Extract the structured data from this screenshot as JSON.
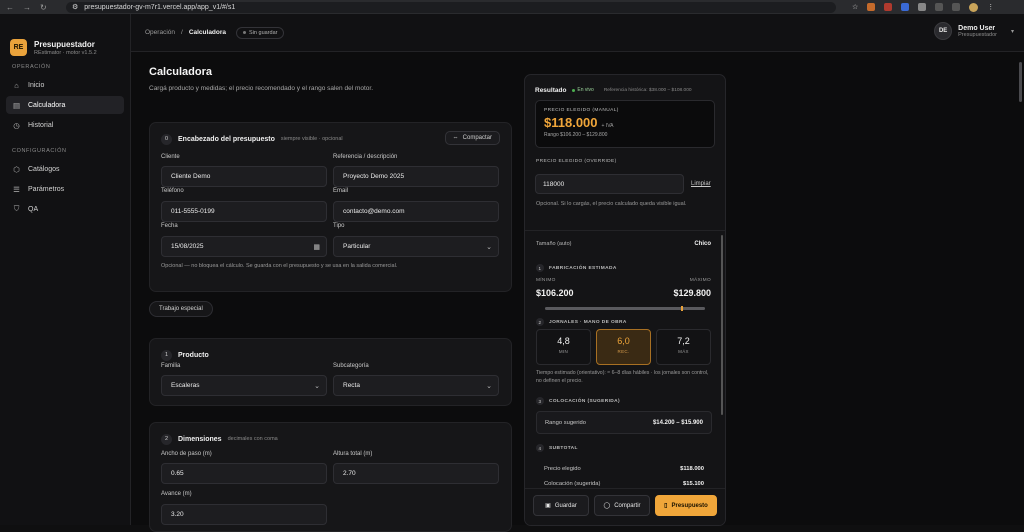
{
  "browser": {
    "url": "presupuestador-gv-m7r1.vercel.app/app_v1/#/s1",
    "nav_back": "←",
    "nav_forward": "→",
    "nav_reload": "↻"
  },
  "sidebar": {
    "brand_initials": "RE",
    "brand_title": "Presupuestador",
    "brand_sub": "REstimator · motor v1.5.2",
    "section_operacion": "OPERACIÓN",
    "section_config": "CONFIGURACIÓN",
    "items": [
      {
        "label": "Inicio",
        "icon": "home-icon",
        "glyph": "⌂"
      },
      {
        "label": "Calculadora",
        "icon": "calculator-icon",
        "glyph": "▤"
      },
      {
        "label": "Historial",
        "icon": "history-icon",
        "glyph": "◷"
      },
      {
        "label": "Catálogos",
        "icon": "catalog-icon",
        "glyph": "⬡"
      },
      {
        "label": "Parámetros",
        "icon": "sliders-icon",
        "glyph": "☰"
      },
      {
        "label": "QA",
        "icon": "shield-icon",
        "glyph": "⛉"
      }
    ]
  },
  "topbar": {
    "crumb_parent": "Operación",
    "crumb_sep": "/",
    "crumb_current": "Calculadora",
    "save_status": "Sin guardar",
    "user_initials": "DE",
    "user_name": "Demo User",
    "user_role": "Presupuestador"
  },
  "page": {
    "title": "Calculadora",
    "desc": "Cargá producto y medidas; el precio recomendado y el rango salen del motor."
  },
  "header_card": {
    "num": "0",
    "title": "Encabezado del presupuesto",
    "hint": "siempre visible · opcional",
    "compact_label": "Compactar",
    "cliente_label": "Cliente",
    "cliente_value": "Cliente Demo",
    "ref_label": "Referencia / descripción",
    "ref_value": "Proyecto Demo 2025",
    "tel_label": "Teléfono",
    "tel_value": "011-5555-0199",
    "email_label": "Email",
    "email_value": "contacto@demo.com",
    "fecha_label": "Fecha",
    "fecha_value": "15/08/2025",
    "tipo_label": "Tipo",
    "tipo_value": "Particular",
    "note": "Opcional — no bloquea el cálculo. Se guarda con el presupuesto y se usa en la salida comercial."
  },
  "chip_trabajo": "Trabajo especial",
  "producto_card": {
    "num": "1",
    "title": "Producto",
    "familia_label": "Familia",
    "familia_value": "Escaleras",
    "subcat_label": "Subcategoría",
    "subcat_value": "Recta"
  },
  "dimensiones_card": {
    "num": "2",
    "title": "Dimensiones",
    "hint": "decimales con coma",
    "ancho_label": "Ancho de paso (m)",
    "ancho_value": "0.65",
    "altura_label": "Altura total (m)",
    "altura_value": "2.70",
    "avance_label": "Avance (m)",
    "avance_value": "3.20"
  },
  "result": {
    "title": "Resultado",
    "live": "En vivo",
    "ref": "Referencia histórica: $38.000 – $108.000",
    "price_label": "PRECIO ELEGIDO (MANUAL)",
    "price_value": "$118.000",
    "price_iva": "+ IVA",
    "price_range": "Rango $106.200 – $129.800",
    "override_label": "PRECIO ELEGIDO (OVERRIDE)",
    "override_value": "118000",
    "clear_label": "Limpiar",
    "override_note": "Opcional. Si lo cargás, el precio calculado queda visible igual.",
    "size_label": "Tamaño (auto)",
    "size_value": "Chico",
    "fab_num": "1",
    "fab_title": "FABRICACIÓN ESTIMADA",
    "min_label": "MÍNIMO",
    "min_value": "$106.200",
    "max_label": "MÁXIMO",
    "max_value": "$129.800",
    "fab_marker_fraction": 0.85,
    "jor_num": "2",
    "jor_title": "JORNALES · MANO DE OBRA",
    "jor_min_value": "4,8",
    "jor_min_label": "MIN",
    "jor_rec_value": "6,0",
    "jor_rec_label": "REC.",
    "jor_max_value": "7,2",
    "jor_max_label": "MÁX",
    "jor_note": "Tiempo estimado (orientativo): ≈ 6–8 días hábiles · los jornales son control, no definen el precio.",
    "col_num": "3",
    "col_title": "COLOCACIÓN (SUGERIDA)",
    "col_label": "Rango sugerido",
    "col_value": "$14.200 – $15.900",
    "sub_num": "4",
    "sub_title": "SUBTOTAL",
    "sub_rows": [
      {
        "label": "Precio elegido",
        "value": "$118.000"
      },
      {
        "label": "Colocación (sugerida)",
        "value": "$15.100"
      }
    ],
    "btn_save": "Guardar",
    "btn_share": "Compartir",
    "btn_quote": "Presupuesto"
  },
  "colors": {
    "accent": "#f0a63a",
    "bg": "#0c0c0d",
    "card": "#161618"
  }
}
